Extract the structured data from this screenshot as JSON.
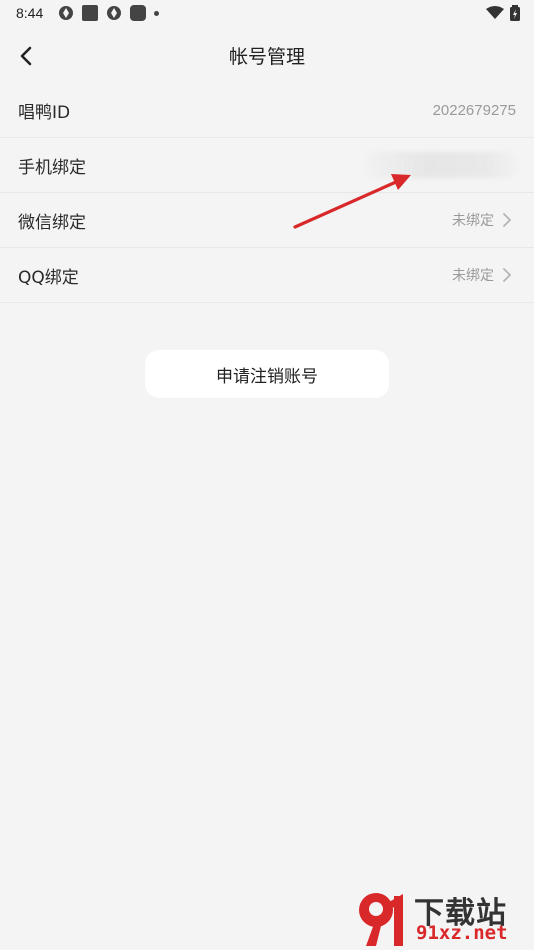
{
  "status_bar": {
    "time": "8:44"
  },
  "header": {
    "title": "帐号管理"
  },
  "rows": [
    {
      "label": "唱鸭ID",
      "value": "2022679275"
    },
    {
      "label": "手机绑定",
      "value": ""
    },
    {
      "label": "微信绑定",
      "value": "未绑定"
    },
    {
      "label": "QQ绑定",
      "value": "未绑定"
    }
  ],
  "deactivate_label": "申请注销账号",
  "watermark": {
    "text": "下载站",
    "domain": "91xz.net"
  },
  "colors": {
    "background": "#f4f4f4",
    "annotation_arrow": "#d9282a"
  }
}
